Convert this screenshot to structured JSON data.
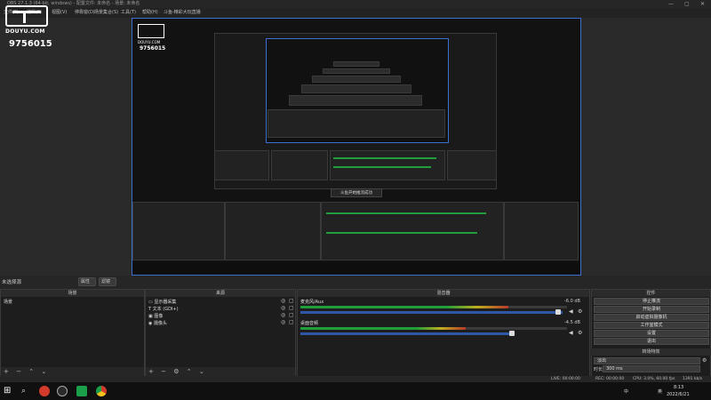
{
  "window": {
    "title": "OBS 27.1.3 (64-bit, windows) - 配置文件: 未命名 - 场景: 未命名",
    "controls": [
      "—",
      "▢",
      "✕"
    ]
  },
  "menu": {
    "items": [
      "文件(F)",
      "编辑(E)",
      "视图(V)",
      "停靠窗(D)",
      "场景集合(S)",
      "工具(T)",
      "帮助(H)",
      "斗鱼-精彩大玩直播"
    ]
  },
  "overlay": {
    "logo_text": "DOUYU.COM",
    "room_id": "9756015",
    "toast": "斗鱼开始推流成功"
  },
  "scene_bar": {
    "label": "未选择源",
    "properties_label": "属性",
    "filters_label": "滤镜"
  },
  "docks": {
    "scenes": {
      "title": "场景",
      "items": [
        "场景"
      ]
    },
    "sources": {
      "title": "来源",
      "items": [
        {
          "icon": "monitor-icon",
          "label": "显示器采集"
        },
        {
          "icon": "text-icon",
          "label": "文本 (GDI+)"
        },
        {
          "icon": "image-icon",
          "label": "图像"
        },
        {
          "icon": "camera-icon",
          "label": "摄像头"
        }
      ]
    },
    "mixer": {
      "title": "混音器",
      "channels": [
        {
          "name": "麦克风/Aux",
          "db": "-6.0 dB",
          "level": 0.78
        },
        {
          "name": "桌面音频",
          "db": "-4.5 dB",
          "level": 0.62
        }
      ]
    },
    "controls": {
      "title": "控件",
      "buttons": [
        "停止推流",
        "开始录制",
        "启动虚拟摄像机",
        "工作室模式",
        "设置",
        "退出"
      ]
    },
    "transitions": {
      "title": "转场特效",
      "selected": "淡出",
      "duration_label": "时长",
      "duration_value": "300 ms"
    }
  },
  "statusbar": {
    "dropped": "LIVE: 00:00:00",
    "rec": "REC: 00:00:00",
    "cpu": "CPU: 3.0%, 60.00 fps",
    "kbps": "1391 kb/s"
  },
  "taskbar": {
    "time": "8:13",
    "date": "2022/6/21",
    "ime": "中",
    "lang": "英"
  },
  "colors": {
    "accent": "#3b6fd1",
    "meter_green": "#1f9e3a",
    "meter_yellow": "#bfae1e",
    "meter_red": "#b43a2a",
    "slider_blue": "#2f57a8"
  }
}
